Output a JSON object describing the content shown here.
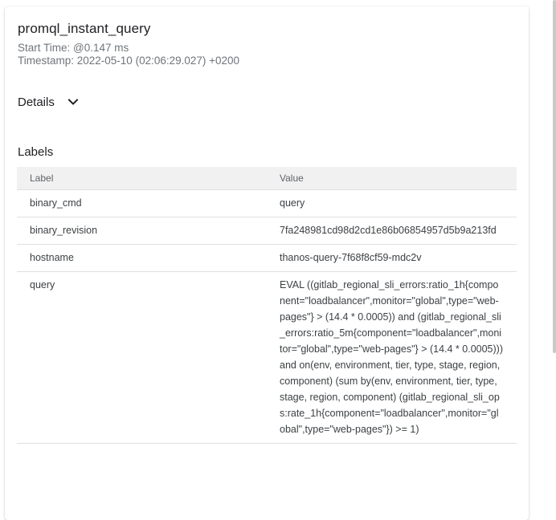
{
  "span": {
    "name": "promql_instant_query",
    "start_time": "Start Time: @0.147 ms",
    "timestamp": "Timestamp: 2022-05-10 (02:06:29.027) +0200"
  },
  "details": {
    "label": "Details",
    "icon": "chevron-down-icon"
  },
  "labels": {
    "heading": "Labels",
    "columns": [
      "Label",
      "Value"
    ],
    "rows": [
      {
        "key": "binary_cmd",
        "value": "query"
      },
      {
        "key": "binary_revision",
        "value": "7fa248981cd98d2cd1e86b06854957d5b9a213fd"
      },
      {
        "key": "hostname",
        "value": "thanos-query-7f68f8cf59-mdc2v"
      },
      {
        "key": "query",
        "value": "EVAL ((gitlab_regional_sli_errors:ratio_1h{component=\"loadbalancer\",monitor=\"global\",type=\"web-pages\"} > (14.4 * 0.0005)) and (gitlab_regional_sli_errors:ratio_5m{component=\"loadbalancer\",monitor=\"global\",type=\"web-pages\"} > (14.4 * 0.0005))) and on(env, environment, tier, type, stage, region, component) (sum by(env, environment, tier, type, stage, region, component) (gitlab_regional_sli_ops:rate_1h{component=\"loadbalancer\",monitor=\"global\",type=\"web-pages\"}) >= 1)"
      }
    ]
  }
}
